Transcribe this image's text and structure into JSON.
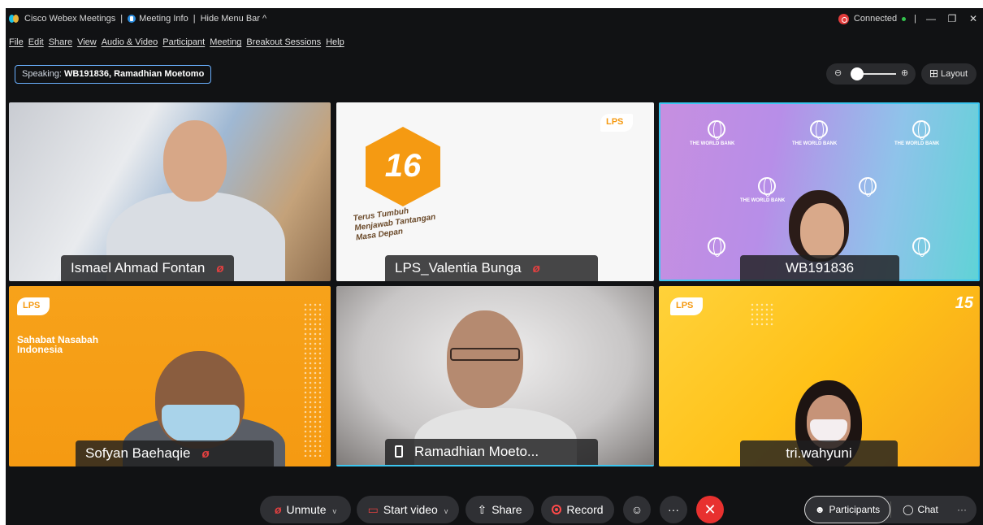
{
  "titlebar": {
    "app_name": "Cisco Webex Meetings",
    "sep1": "|",
    "meeting_info": "Meeting Info",
    "sep2": "|",
    "hide_menu": "Hide Menu Bar ^",
    "connection_status": "Connected",
    "sep3": "|"
  },
  "window_controls": {
    "minimize": "—",
    "restore": "❐",
    "close": "✕"
  },
  "menu": [
    "File",
    "Edit",
    "Share",
    "View",
    "Audio & Video",
    "Participant",
    "Meeting",
    "Breakout Sessions",
    "Help"
  ],
  "speaking": {
    "prefix": "Speaking:",
    "names": "WB191836, Ramadhian Moetomo"
  },
  "zoom": {
    "zoom_out": "⊖",
    "zoom_in": "⊕",
    "level": 0.1
  },
  "layout_button": "Layout",
  "tiles": [
    {
      "name": "Ismael Ahmad Fontan",
      "muted": true
    },
    {
      "name": "LPS_Valentia Bunga",
      "muted": true,
      "bg_text_number": "16",
      "bg_tagline": "Terus Tumbuh Menjawab Tantangan Masa Depan"
    },
    {
      "name": "WB191836",
      "muted": false,
      "active": true,
      "bg_brand": "THE WORLD BANK"
    },
    {
      "name": "Sofyan Baehaqie",
      "muted": true,
      "bg_tagline": "Sahabat Nasabah Indonesia"
    },
    {
      "name": "Ramadhian Moeto...",
      "muted": false,
      "device": "phone"
    },
    {
      "name": "tri.wahyuni",
      "muted": false,
      "bg_text_number": "15"
    }
  ],
  "toolbar": {
    "unmute": "Unmute",
    "start_video": "Start video",
    "share": "Share",
    "record": "Record",
    "reactions_icon": "☺",
    "more": "···",
    "end": "✕",
    "participants": "Participants",
    "chat": "Chat",
    "more_right": "···"
  },
  "colors": {
    "accent": "#3cc6f0",
    "muted_red": "#e24040",
    "end_red": "#e8312f",
    "lps_orange": "#f59a12"
  }
}
